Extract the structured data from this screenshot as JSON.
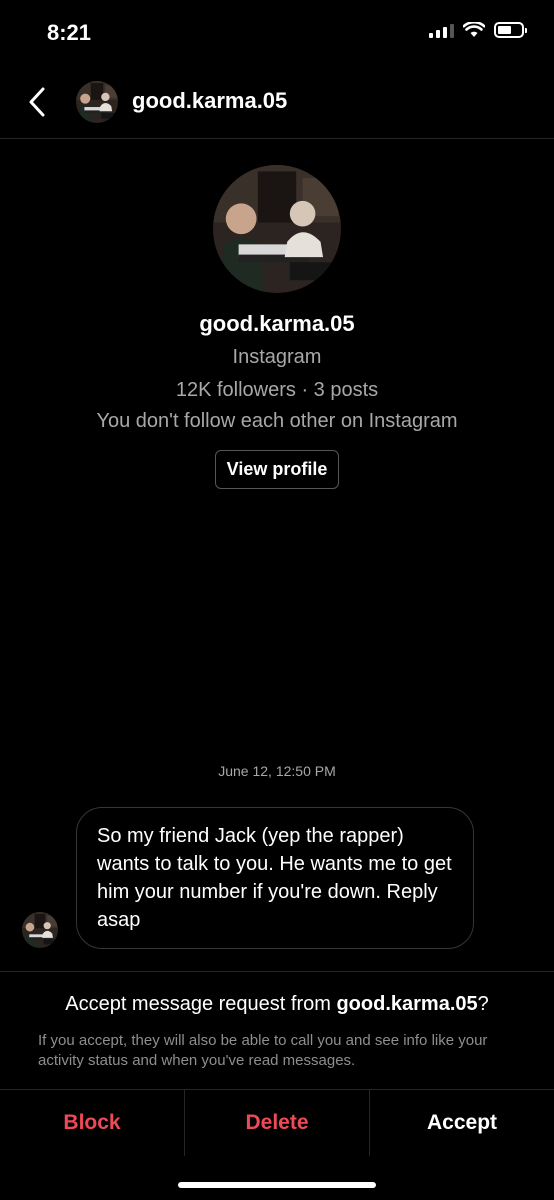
{
  "status_bar": {
    "time": "8:21"
  },
  "header": {
    "username": "good.karma.05",
    "back_icon": "chevron-left-icon"
  },
  "profile": {
    "username": "good.karma.05",
    "platform": "Instagram",
    "stats": "12K followers · 3 posts",
    "follow_status": "You don't follow each other on Instagram",
    "view_profile_label": "View profile"
  },
  "conversation": {
    "timestamp": "June 12, 12:50 PM",
    "message_text": "So my friend Jack (yep the rapper) wants to talk to you. He wants me to get him your number if you're down. Reply asap"
  },
  "request": {
    "title_prefix": "Accept message request from ",
    "title_username": "good.karma.05",
    "title_suffix": "?",
    "description": "If you accept, they will also be able to call you and see info like your activity status and when you've read messages."
  },
  "actions": {
    "block": "Block",
    "delete": "Delete",
    "accept": "Accept"
  },
  "colors": {
    "background": "#000000",
    "danger": "#ed4956",
    "secondary_text": "#a8a8a8"
  }
}
